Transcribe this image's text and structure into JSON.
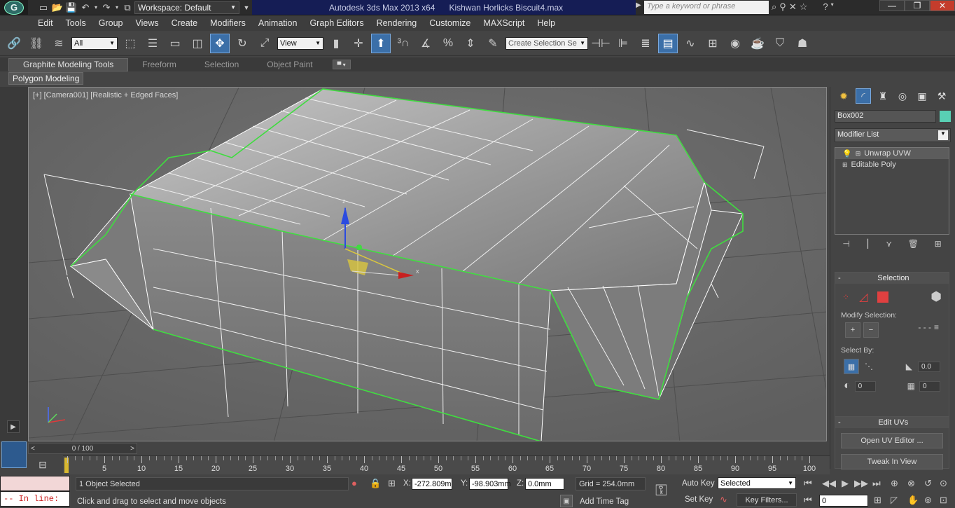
{
  "titlebar": {
    "workspace": "Workspace: Default",
    "app_title": "Autodesk 3ds Max  2013 x64",
    "file_title": "Kishwan Horlicks Biscuit4.max",
    "search_placeholder": "Type a keyword or phrase"
  },
  "menu": [
    "Edit",
    "Tools",
    "Group",
    "Views",
    "Create",
    "Modifiers",
    "Animation",
    "Graph Editors",
    "Rendering",
    "Customize",
    "MAXScript",
    "Help"
  ],
  "toolbar": {
    "filter_value": "All",
    "refcoord_value": "View",
    "selection_set_placeholder": "Create Selection Se"
  },
  "ribbon": {
    "tabs": [
      "Graphite Modeling Tools",
      "Freeform",
      "Selection",
      "Object Paint"
    ],
    "panel": "Polygon Modeling"
  },
  "viewport": {
    "label": "[+] [Camera001] [Realistic + Edged Faces]"
  },
  "command_panel": {
    "object_name": "Box002",
    "object_color": "#59d0b4",
    "modifier_list": "Modifier List",
    "stack": [
      "Unwrap UVW",
      "Editable Poly"
    ],
    "selection_rollout": {
      "title": "Selection",
      "modify_selection": "Modify Selection:",
      "select_by": "Select By:",
      "spinner1": "0.0",
      "spinner2": "0",
      "spinner3": "0"
    },
    "edit_uvs_rollout": {
      "title": "Edit UVs",
      "open_uv_editor": "Open UV Editor ...",
      "tweak_in_view": "Tweak In View"
    }
  },
  "timeline": {
    "time_display": "0 / 100",
    "ticks": [
      5,
      10,
      15,
      20,
      25,
      30,
      35,
      40,
      45,
      50,
      55,
      60,
      65,
      70,
      75,
      80,
      85,
      90,
      95,
      100
    ]
  },
  "status": {
    "maxscript_prompt": "--  In line:",
    "objects_selected": "1 Object Selected",
    "prompt": "Click and drag to select and move objects",
    "x_label": "X:",
    "x_value": "-272.809m",
    "y_label": "Y:",
    "y_value": "-98.903mm",
    "z_label": "Z:",
    "z_value": "0.0mm",
    "grid": "Grid = 254.0mm",
    "add_time_tag": "Add Time Tag",
    "auto_key": "Auto Key",
    "set_key": "Set Key",
    "key_mode_value": "Selected",
    "key_filters": "Key Filters...",
    "frame_value": "0"
  }
}
